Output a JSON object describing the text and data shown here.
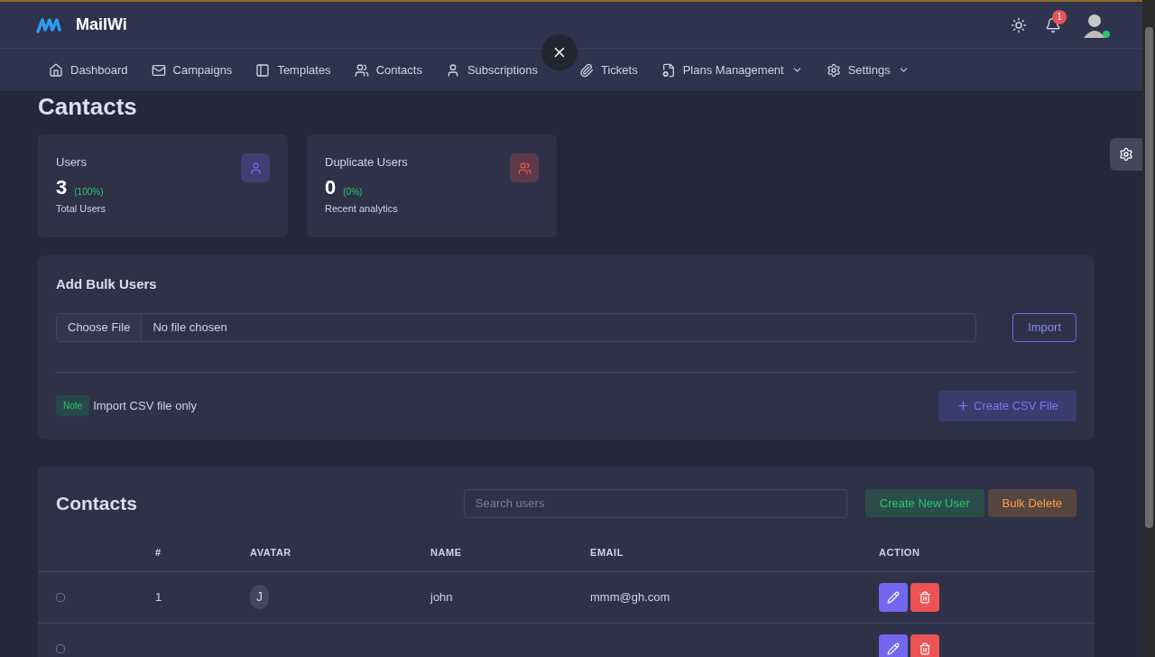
{
  "brand": "MailWi",
  "header": {
    "notification_count": "1",
    "online": true
  },
  "nav": [
    {
      "label": "Dashboard",
      "dropdown": false
    },
    {
      "label": "Campaigns",
      "dropdown": false
    },
    {
      "label": "Templates",
      "dropdown": false
    },
    {
      "label": "Contacts",
      "dropdown": false
    },
    {
      "label": "Subscriptions",
      "dropdown": false
    },
    {
      "label": "Tickets",
      "dropdown": false
    },
    {
      "label": "Plans Management",
      "dropdown": true
    },
    {
      "label": "Settings",
      "dropdown": true
    }
  ],
  "page_title": "Cantacts",
  "stats": [
    {
      "label": "Users",
      "value": "3",
      "percent": "(100%)",
      "caption": "Total Users",
      "kind": "user",
      "color": "#7367f0"
    },
    {
      "label": "Duplicate Users",
      "value": "0",
      "percent": "(0%)",
      "caption": "Recent analytics",
      "kind": "users",
      "color": "#ea5455"
    }
  ],
  "bulk": {
    "title": "Add Bulk Users",
    "file_button": "Choose File",
    "file_status": "No file chosen",
    "import_button": "Import",
    "note_badge": "Note",
    "note_text": "Import CSV file only",
    "create_button": "Create CSV File"
  },
  "contacts": {
    "title": "Contacts",
    "search_placeholder": "Search users",
    "create_button": "Create New User",
    "delete_button": "Bulk Delete",
    "columns": [
      "#",
      "AVATAR",
      "NAME",
      "EMAIL",
      "ACTION"
    ],
    "rows": [
      {
        "checked": false,
        "number": "1",
        "avatar": "J",
        "name": "john",
        "email": "mmm@gh.com"
      },
      {
        "checked": false
      }
    ]
  }
}
